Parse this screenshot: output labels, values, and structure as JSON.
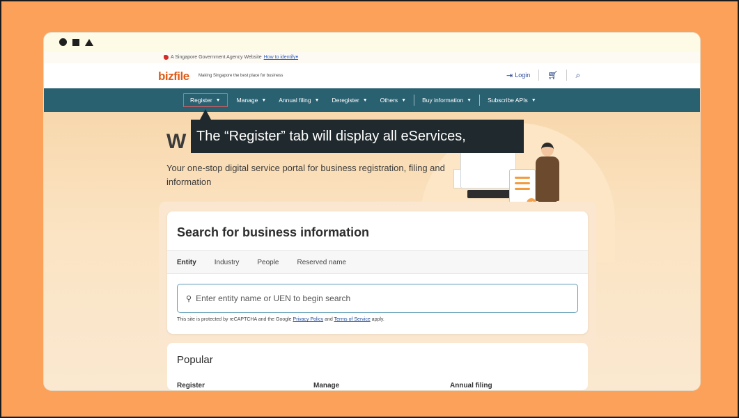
{
  "gov_banner": {
    "text": "A Singapore Government Agency Website",
    "link": "How to identify",
    "link_caret": "▾"
  },
  "header": {
    "logo": "bizfile",
    "tagline": "Making Singapore the best place for business",
    "login_label": "Login"
  },
  "nav": {
    "items": [
      {
        "label": "Register",
        "active": true
      },
      {
        "label": "Manage"
      },
      {
        "label": "Annual filing"
      },
      {
        "label": "Deregister"
      },
      {
        "label": "Others"
      },
      {
        "label": "Buy information"
      },
      {
        "label": "Subscribe APIs"
      }
    ],
    "caret": "▼"
  },
  "hero": {
    "title_visible": "W",
    "description": "Your one-stop digital service portal for business registration, filing and information"
  },
  "callout": {
    "text": "The “Register” tab will display all eServices,"
  },
  "search": {
    "title": "Search for business information",
    "tabs": [
      "Entity",
      "Industry",
      "People",
      "Reserved name"
    ],
    "placeholder": "Enter entity name or UEN to begin search",
    "captcha_prefix": "This site is protected by reCAPTCHA and the Google",
    "privacy_link": "Privacy Policy",
    "and_text": "and",
    "terms_link": "Terms of Service",
    "captcha_suffix": "apply."
  },
  "popular": {
    "title": "Popular",
    "columns": [
      "Register",
      "Manage",
      "Annual filing"
    ]
  },
  "colors": {
    "page_bg": "#fba15a",
    "nav_bg": "#2a6171",
    "logo": "#e15b17",
    "callout_bg": "#202a2e",
    "active_outline": "#f25a5a"
  }
}
